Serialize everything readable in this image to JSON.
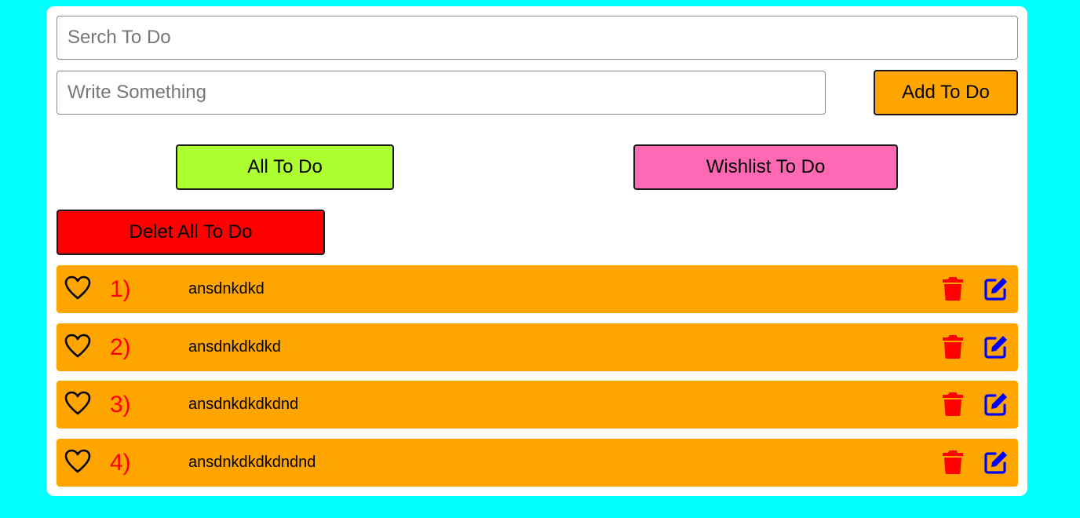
{
  "colors": {
    "background": "#00ffff",
    "card": "#ffffff",
    "add_button": "#ffa500",
    "all_button": "#adff2f",
    "wishlist_button": "#ff69b4",
    "delete_all_button": "#ff0000",
    "todo_item": "#ffa500",
    "number_text": "#ff0000",
    "trash_icon": "#ff0000",
    "edit_icon": "#0000ff"
  },
  "search": {
    "placeholder": "Serch To Do",
    "value": ""
  },
  "new_todo": {
    "placeholder": "Write Something",
    "value": "",
    "add_label": "Add To Do"
  },
  "filters": {
    "all_label": "All To Do",
    "wishlist_label": "Wishlist To Do"
  },
  "delete_all_label": "Delet All To Do",
  "todos": [
    {
      "number": "1)",
      "text": "ansdnkdkd",
      "heart_icon": "heart-outline-icon",
      "delete_icon": "trash-icon",
      "edit_icon": "edit-icon"
    },
    {
      "number": "2)",
      "text": "ansdnkdkdkd",
      "heart_icon": "heart-outline-icon",
      "delete_icon": "trash-icon",
      "edit_icon": "edit-icon"
    },
    {
      "number": "3)",
      "text": "ansdnkdkdkdnd",
      "heart_icon": "heart-outline-icon",
      "delete_icon": "trash-icon",
      "edit_icon": "edit-icon"
    },
    {
      "number": "4)",
      "text": "ansdnkdkdkdndnd",
      "heart_icon": "heart-outline-icon",
      "delete_icon": "trash-icon",
      "edit_icon": "edit-icon"
    }
  ]
}
